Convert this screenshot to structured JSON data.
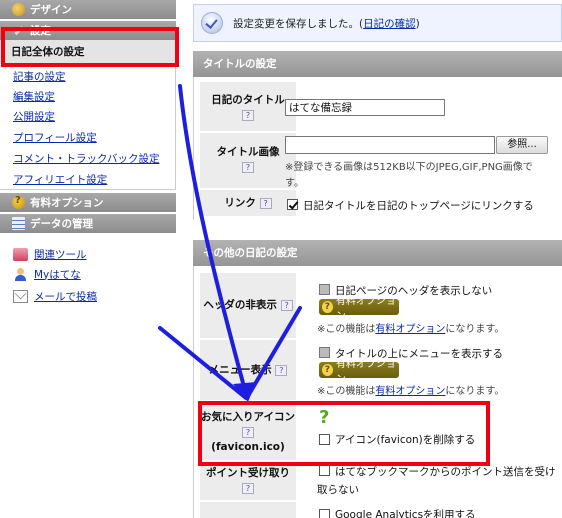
{
  "sidebar": {
    "design_header": "デザイン",
    "settings_header": "設定",
    "all_settings": "日記全体の設定",
    "links": [
      "記事の設定",
      "編集設定",
      "公開設定",
      "プロフィール設定",
      "コメント・トラックバック設定",
      "アフィリエイト設定"
    ],
    "option_header": "有料オプション",
    "data_header": "データの管理",
    "tools": [
      {
        "icon": "tools-icon",
        "label": "関連ツール"
      },
      {
        "icon": "user-icon",
        "label": "Myはてな"
      },
      {
        "icon": "mail-icon",
        "label": "メールで投稿"
      }
    ]
  },
  "notice": {
    "message": "設定変更を保存しました。(",
    "link": "日記の確認",
    "close": ")"
  },
  "title_panel": {
    "header": "タイトルの設定",
    "rows": {
      "diary_title": {
        "label": "日記のタイトル",
        "help": "?",
        "value": "はてな備忘録"
      },
      "title_image": {
        "label": "タイトル画像",
        "help": "?",
        "browse": "参照...",
        "note_line1": "※登録できる画像は512KB以下のJPEG,GIF,PNG画像で",
        "note_line2": "す。"
      },
      "link": {
        "label": "リンク",
        "help": "?",
        "checkbox": "日記タイトルを日記のトップページにリンクする"
      }
    }
  },
  "other_panel": {
    "header": "その他の日記の設定",
    "rows": {
      "hide_header": {
        "label": "ヘッダの非表示",
        "help": "?",
        "checkbox": "日記ページのヘッダを表示しない",
        "badge": "有料オプション",
        "note_prefix": "※この機能は",
        "note_link": "有料オプション",
        "note_suffix": "になります。"
      },
      "menu_display": {
        "label": "メニュー表示",
        "help": "?",
        "checkbox": "タイトルの上にメニューを表示する",
        "badge": "有料オプション",
        "note_prefix": "※この機能は",
        "note_link": "有料オプション",
        "note_suffix": "になります。"
      },
      "favicon": {
        "label": "お気に入りアイコン",
        "help": "?",
        "sublabel": "(favicon.ico)",
        "icon_glyph": "?",
        "checkbox": "アイコン(favicon)を削除する"
      },
      "point": {
        "label": "ポイント受け取り",
        "help": "?",
        "checkbox_line1": "はてなブックマークからのポイント送信を受け",
        "checkbox_line2": "取らない"
      },
      "analytics": {
        "checkbox": "Google Analyticsを利用する"
      }
    }
  },
  "colors": {
    "highlight": "#f00010",
    "arrow": "#1e1ee0",
    "link": "#0a2aa8"
  }
}
